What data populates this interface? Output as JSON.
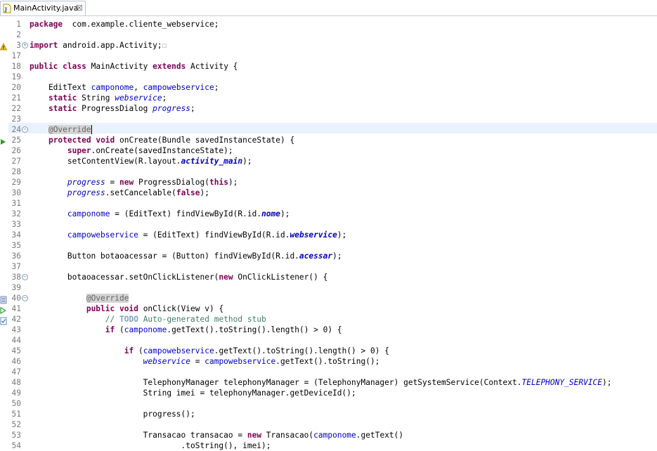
{
  "tab": {
    "label": "MainActivity.java",
    "close_glyph": "☒",
    "file_icon": "java-file-icon"
  },
  "lines": [
    {
      "n": "1",
      "fold": "",
      "segs": [
        [
          "kw",
          "package"
        ],
        [
          "",
          "  com.example.cliente_webservice;"
        ]
      ]
    },
    {
      "n": "2",
      "fold": "",
      "segs": []
    },
    {
      "n": "3",
      "fold": "+",
      "segs": [
        [
          "kw",
          "import"
        ],
        [
          "",
          " android.app.Activity;"
        ]
      ],
      "marker": "warning"
    },
    {
      "n": "17",
      "fold": "",
      "segs": []
    },
    {
      "n": "18",
      "fold": "",
      "segs": [
        [
          "kw",
          "public"
        ],
        [
          "",
          " "
        ],
        [
          "kw",
          "class"
        ],
        [
          "",
          " MainActivity "
        ],
        [
          "kw",
          "extends"
        ],
        [
          "",
          " Activity {"
        ]
      ]
    },
    {
      "n": "19",
      "fold": "",
      "segs": []
    },
    {
      "n": "20",
      "fold": "",
      "segs": [
        [
          "",
          "    EditText "
        ],
        [
          "fld",
          "camponome"
        ],
        [
          "",
          ", "
        ],
        [
          "fld",
          "campowebservice"
        ],
        [
          "",
          ";"
        ]
      ]
    },
    {
      "n": "21",
      "fold": "",
      "segs": [
        [
          "",
          "    "
        ],
        [
          "kw",
          "static"
        ],
        [
          "",
          " String "
        ],
        [
          "sfld",
          "webservice"
        ],
        [
          "",
          ";"
        ]
      ]
    },
    {
      "n": "22",
      "fold": "",
      "segs": [
        [
          "",
          "    "
        ],
        [
          "kw",
          "static"
        ],
        [
          "",
          " ProgressDialog "
        ],
        [
          "sfld",
          "progress"
        ],
        [
          "",
          ";"
        ]
      ]
    },
    {
      "n": "23",
      "fold": "",
      "segs": []
    },
    {
      "n": "24",
      "fold": "-",
      "segs": [
        [
          "",
          "    "
        ],
        [
          "ann",
          "@Override"
        ]
      ],
      "current": true
    },
    {
      "n": "25",
      "fold": "",
      "segs": [
        [
          "",
          "    "
        ],
        [
          "kw",
          "protected"
        ],
        [
          "",
          " "
        ],
        [
          "kw",
          "void"
        ],
        [
          "",
          " onCreate(Bundle savedInstanceState) {"
        ]
      ],
      "marker": "override"
    },
    {
      "n": "26",
      "fold": "",
      "segs": [
        [
          "",
          "        "
        ],
        [
          "kw",
          "super"
        ],
        [
          "",
          ".onCreate(savedInstanceState);"
        ]
      ]
    },
    {
      "n": "27",
      "fold": "",
      "segs": [
        [
          "",
          "        setContentView(R.layout."
        ],
        [
          "cfld",
          "activity_main"
        ],
        [
          "",
          ");"
        ]
      ]
    },
    {
      "n": "28",
      "fold": "",
      "segs": []
    },
    {
      "n": "29",
      "fold": "",
      "segs": [
        [
          "",
          "        "
        ],
        [
          "sfld",
          "progress"
        ],
        [
          "",
          " = "
        ],
        [
          "kw",
          "new"
        ],
        [
          "",
          " ProgressDialog("
        ],
        [
          "kw",
          "this"
        ],
        [
          "",
          ");"
        ]
      ]
    },
    {
      "n": "30",
      "fold": "",
      "segs": [
        [
          "",
          "        "
        ],
        [
          "sfld",
          "progress"
        ],
        [
          "",
          ".setCancelable("
        ],
        [
          "kw",
          "false"
        ],
        [
          "",
          ");"
        ]
      ]
    },
    {
      "n": "31",
      "fold": "",
      "segs": []
    },
    {
      "n": "32",
      "fold": "",
      "segs": [
        [
          "",
          "        "
        ],
        [
          "fld",
          "camponome"
        ],
        [
          "",
          " = (EditText) findViewById(R.id."
        ],
        [
          "cfld",
          "nome"
        ],
        [
          "",
          ");"
        ]
      ]
    },
    {
      "n": "33",
      "fold": "",
      "segs": []
    },
    {
      "n": "34",
      "fold": "",
      "segs": [
        [
          "",
          "        "
        ],
        [
          "fld",
          "campowebservice"
        ],
        [
          "",
          " = (EditText) findViewById(R.id."
        ],
        [
          "cfld",
          "webservice"
        ],
        [
          "",
          ");"
        ]
      ]
    },
    {
      "n": "35",
      "fold": "",
      "segs": []
    },
    {
      "n": "36",
      "fold": "",
      "segs": [
        [
          "",
          "        Button botaoacessar = (Button) findViewById(R.id."
        ],
        [
          "cfld",
          "acessar"
        ],
        [
          "",
          ");"
        ]
      ]
    },
    {
      "n": "37",
      "fold": "",
      "segs": []
    },
    {
      "n": "38",
      "fold": "-",
      "segs": [
        [
          "",
          "        botaoacessar.setOnClickListener("
        ],
        [
          "kw",
          "new"
        ],
        [
          "",
          " OnClickListener() {"
        ]
      ]
    },
    {
      "n": "39",
      "fold": "",
      "segs": []
    },
    {
      "n": "40",
      "fold": "-",
      "segs": [
        [
          "",
          "            "
        ],
        [
          "ann",
          "@Override"
        ]
      ],
      "marker": "doc"
    },
    {
      "n": "41",
      "fold": "",
      "segs": [
        [
          "",
          "            "
        ],
        [
          "kw",
          "public"
        ],
        [
          "",
          " "
        ],
        [
          "kw",
          "void"
        ],
        [
          "",
          " onClick(View v) {"
        ]
      ],
      "marker": "implements"
    },
    {
      "n": "42",
      "fold": "",
      "segs": [
        [
          "",
          "                "
        ],
        [
          "cmt",
          "// "
        ],
        [
          "todo",
          "TODO"
        ],
        [
          "cmt",
          " Auto-generated method stub"
        ]
      ],
      "marker": "task"
    },
    {
      "n": "43",
      "fold": "",
      "segs": [
        [
          "",
          "                "
        ],
        [
          "kw",
          "if"
        ],
        [
          "",
          " ("
        ],
        [
          "fld",
          "camponome"
        ],
        [
          "",
          ".getText().toString().length() > 0) {"
        ]
      ]
    },
    {
      "n": "44",
      "fold": "",
      "segs": []
    },
    {
      "n": "45",
      "fold": "",
      "segs": [
        [
          "",
          "                    "
        ],
        [
          "kw",
          "if"
        ],
        [
          "",
          " ("
        ],
        [
          "fld",
          "campowebservice"
        ],
        [
          "",
          ".getText().toString().length() > 0) {"
        ]
      ]
    },
    {
      "n": "46",
      "fold": "",
      "segs": [
        [
          "",
          "                        "
        ],
        [
          "sfld",
          "webservice"
        ],
        [
          "",
          " = "
        ],
        [
          "fld",
          "campowebservice"
        ],
        [
          "",
          ".getText().toString();"
        ]
      ]
    },
    {
      "n": "47",
      "fold": "",
      "segs": []
    },
    {
      "n": "48",
      "fold": "",
      "segs": [
        [
          "",
          "                        TelephonyManager telephonyManager = (TelephonyManager) getSystemService(Context."
        ],
        [
          "sfld",
          "TELEPHONY_SERVICE"
        ],
        [
          "",
          ");"
        ]
      ]
    },
    {
      "n": "49",
      "fold": "",
      "segs": [
        [
          "",
          "                        String imei = telephonyManager.getDeviceId();"
        ]
      ]
    },
    {
      "n": "50",
      "fold": "",
      "segs": []
    },
    {
      "n": "51",
      "fold": "",
      "segs": [
        [
          "",
          "                        progress();"
        ]
      ]
    },
    {
      "n": "52",
      "fold": "",
      "segs": []
    },
    {
      "n": "53",
      "fold": "",
      "segs": [
        [
          "",
          "                        Transacao transacao = "
        ],
        [
          "kw",
          "new"
        ],
        [
          "",
          " Transacao("
        ],
        [
          "fld",
          "camponome"
        ],
        [
          "",
          ".getText()"
        ]
      ]
    },
    {
      "n": "54",
      "fold": "",
      "segs": [
        [
          "",
          "                                .toString(), imei);"
        ]
      ]
    }
  ],
  "colors": {
    "keyword": "#7f0055",
    "field": "#0000c0",
    "comment": "#3f7f5f",
    "current_line": "#e8f2fe"
  }
}
